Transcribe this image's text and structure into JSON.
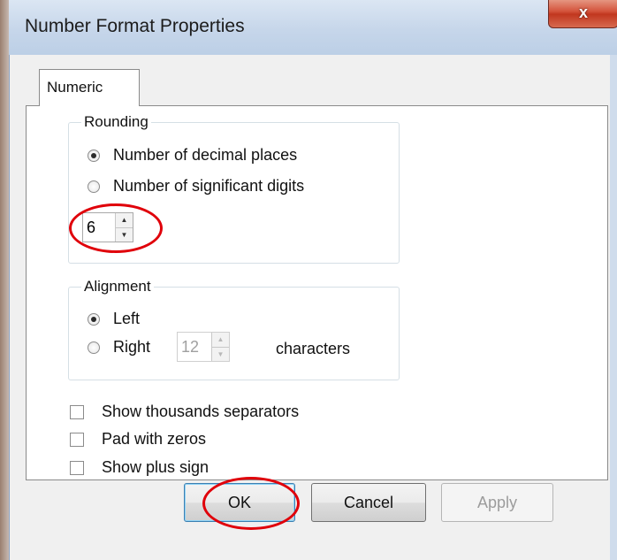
{
  "window": {
    "title": "Number Format Properties",
    "close_glyph": "x"
  },
  "tabs": [
    {
      "label": "Numeric",
      "selected": true
    }
  ],
  "rounding": {
    "legend": "Rounding",
    "options": [
      {
        "label": "Number of decimal places",
        "checked": true
      },
      {
        "label": "Number of significant digits",
        "checked": false
      }
    ],
    "value": "6"
  },
  "alignment": {
    "legend": "Alignment",
    "left_label": "Left",
    "right_label": "Right",
    "selected": "Left",
    "width_value": "12",
    "width_enabled": false,
    "width_unit": "characters"
  },
  "checkboxes": [
    {
      "label": "Show thousands separators",
      "checked": false
    },
    {
      "label": "Pad with zeros",
      "checked": false
    },
    {
      "label": "Show plus sign",
      "checked": false
    }
  ],
  "buttons": {
    "ok": "OK",
    "cancel": "Cancel",
    "apply": "Apply",
    "apply_enabled": false
  },
  "annotations": {
    "highlight_color": "#e0000a"
  },
  "colors": {
    "titlebar": "#c6d6ea",
    "close_button": "#c1371f",
    "dialog_background": "#f0f0f0"
  }
}
